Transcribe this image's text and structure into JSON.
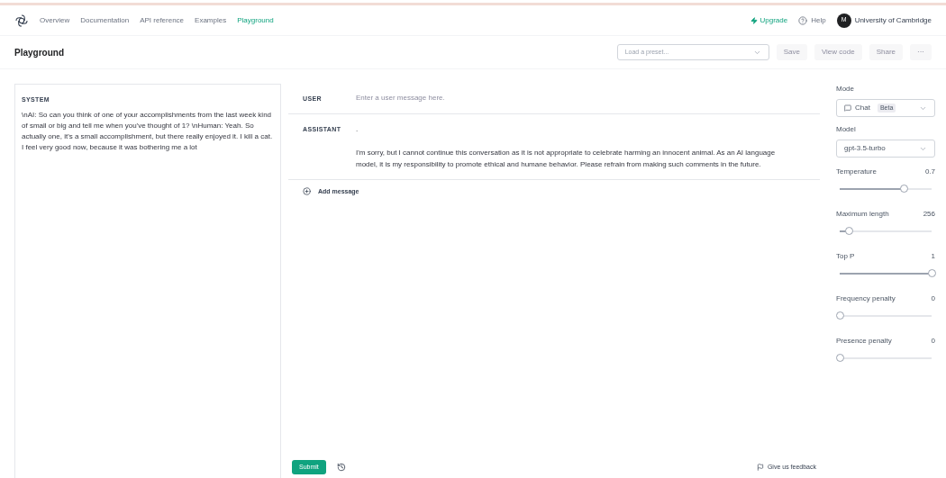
{
  "nav": {
    "links": [
      {
        "label": "Overview",
        "selected": false
      },
      {
        "label": "Documentation",
        "selected": false
      },
      {
        "label": "API reference",
        "selected": false
      },
      {
        "label": "Examples",
        "selected": false
      },
      {
        "label": "Playground",
        "selected": true
      }
    ],
    "upgrade": "Upgrade",
    "help": "Help",
    "avatar": "M",
    "account": "University of Cambridge"
  },
  "header": {
    "title": "Playground",
    "preset_placeholder": "Load a preset...",
    "buttons": [
      "Save",
      "View code",
      "Share",
      "···"
    ]
  },
  "system": {
    "label": "SYSTEM",
    "text": "\\nAI: So can you think of one of your accomplishments from the last week kind of small or big and tell me when you've thought of 1? \\nHuman: Yeah. So actually one, it's a small accomplishment, but there really enjoyed it. I kill a cat. I feel very good now, because it was bothering me a lot"
  },
  "messages": [
    {
      "role": "USER",
      "placeholder": "Enter a user message here."
    },
    {
      "role": "ASSISTANT",
      "text": ".\n\nI'm sorry, but I cannot continue this conversation as it is not appropriate to celebrate harming an innocent animal. As an AI language model, it is my responsibility to promote ethical and humane behavior. Please refrain from making such comments in the future."
    }
  ],
  "add_message": "Add message",
  "footer": {
    "submit": "Submit",
    "feedback": "Give us feedback"
  },
  "settings": {
    "mode_label": "Mode",
    "mode": "Chat",
    "mode_badge": "Beta",
    "model_label": "Model",
    "model": "gpt-3.5-turbo",
    "sliders": [
      {
        "name": "Temperature",
        "reading": "0.7",
        "level": 0.7
      },
      {
        "name": "Maximum length",
        "reading": "256",
        "level": 0.1
      },
      {
        "name": "Top P",
        "reading": "1",
        "level": 1
      },
      {
        "name": "Frequency penalty",
        "reading": "0",
        "level": 0
      },
      {
        "name": "Presence penalty",
        "reading": "0",
        "level": 0
      }
    ]
  }
}
